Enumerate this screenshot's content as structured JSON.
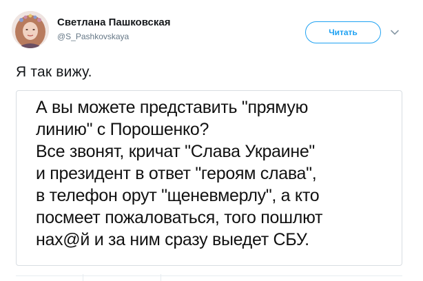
{
  "tweet": {
    "author": {
      "display_name": "Светлана Пашковская",
      "screen_name": "@S_Pashkovskaya",
      "avatar": "profile-photo"
    },
    "follow_label": "Читать",
    "text": "Я так вижу.",
    "quote_image": {
      "lines": [
        "А вы можете представить \"прямую",
        "линию\" с Порошенко?",
        "Все звонят, кричат \"Слава Украине\"",
        "и президент в ответ \"героям слава\",",
        "в телефон орут \"щеневмерлу\", а кто",
        "посмеет пожаловаться, того пошлют",
        "нах@й и за ним сразу выедет СБУ."
      ]
    }
  },
  "icons": {
    "more": "chevron-down-icon"
  },
  "colors": {
    "accent": "#1da1f2",
    "secondary_text": "#657786",
    "border": "#d8dde2"
  }
}
